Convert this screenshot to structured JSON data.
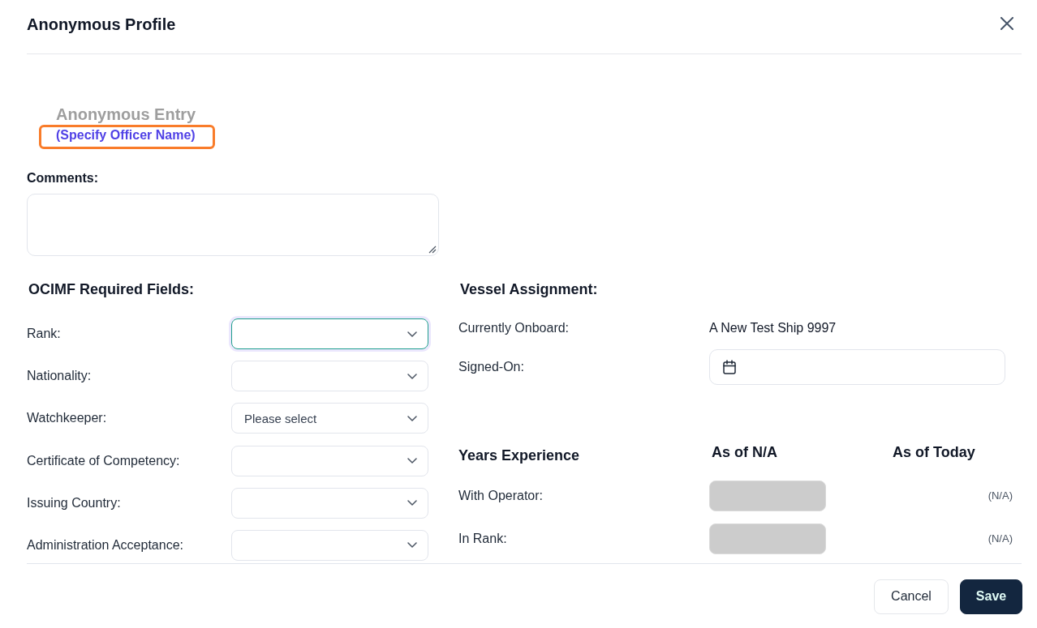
{
  "dialog": {
    "title": "Anonymous Profile"
  },
  "entry": {
    "title": "Anonymous Entry",
    "link": "(Specify Officer Name)",
    "highlighted": true
  },
  "comments": {
    "label": "Comments:"
  },
  "ocimf": {
    "heading": "OCIMF Required Fields:",
    "fields": [
      {
        "label": "Rank:",
        "focused": true
      },
      {
        "label": "Nationality:",
        "focused": false
      },
      {
        "label": "Watchkeeper:",
        "value": "Please select",
        "focused": false
      },
      {
        "label": "Certificate of Competency:",
        "focused": false
      },
      {
        "label": "Issuing Country:",
        "focused": false
      },
      {
        "label": "Administration Acceptance:",
        "focused": false
      }
    ]
  },
  "vessel": {
    "heading": "Vessel Assignment:",
    "rows": [
      {
        "kind": "text",
        "label": "Currently Onboard:",
        "value": "A New Test Ship 9997"
      },
      {
        "kind": "date",
        "label": "Signed-On:"
      }
    ]
  },
  "experience": {
    "heading": "Years Experience",
    "columns": [
      "As of N/A",
      "As of Today"
    ],
    "rows": [
      {
        "label": "With Operator:",
        "disabled": true,
        "today": "(N/A)"
      },
      {
        "label": "In Rank:",
        "disabled": true,
        "today": "(N/A)"
      }
    ]
  },
  "buttons": [
    {
      "label": "Cancel",
      "kind": "secondary"
    },
    {
      "label": "Save",
      "kind": "primary"
    }
  ]
}
